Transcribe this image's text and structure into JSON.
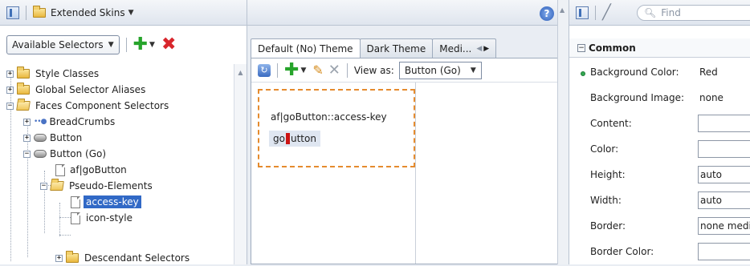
{
  "left": {
    "toolbar": {
      "title": "Extended Skins"
    },
    "selector_dropdown": "Available Selectors",
    "tree": [
      {
        "label": "Style Classes"
      },
      {
        "label": "Global Selector Aliases"
      },
      {
        "label": "Faces Component Selectors"
      },
      {
        "label": "BreadCrumbs"
      },
      {
        "label": "Button"
      },
      {
        "label": "Button (Go)"
      },
      {
        "label": "af|goButton"
      },
      {
        "label": "Pseudo-Elements"
      },
      {
        "label": "access-key"
      },
      {
        "label": "icon-style"
      },
      {
        "label": "Descendant Selectors"
      }
    ]
  },
  "middle": {
    "tabs": [
      {
        "label": "Default (No) Theme"
      },
      {
        "label": "Dark Theme"
      },
      {
        "label": "Medi..."
      }
    ],
    "view_as_label": "View as:",
    "view_as_value": "Button (Go)",
    "preview_label": "af|goButton::access-key",
    "preview_button": {
      "before": "go",
      "after": "utton"
    },
    "help": "?"
  },
  "right": {
    "find_placeholder": "Find",
    "section": "Common",
    "properties": [
      {
        "label": "Background Color:",
        "value": "Red",
        "set": true,
        "plain": true
      },
      {
        "label": "Background Image:",
        "value": "none",
        "set": false,
        "plain": true
      },
      {
        "label": "Content:",
        "value": "",
        "set": false,
        "plain": false
      },
      {
        "label": "Color:",
        "value": "",
        "set": false,
        "plain": false
      },
      {
        "label": "Height:",
        "value": "auto",
        "set": false,
        "plain": false
      },
      {
        "label": "Width:",
        "value": "auto",
        "set": false,
        "plain": false
      },
      {
        "label": "Border:",
        "value": "none medi",
        "set": false,
        "plain": false
      },
      {
        "label": "Border Color:",
        "value": "",
        "set": false,
        "plain": false
      }
    ]
  }
}
